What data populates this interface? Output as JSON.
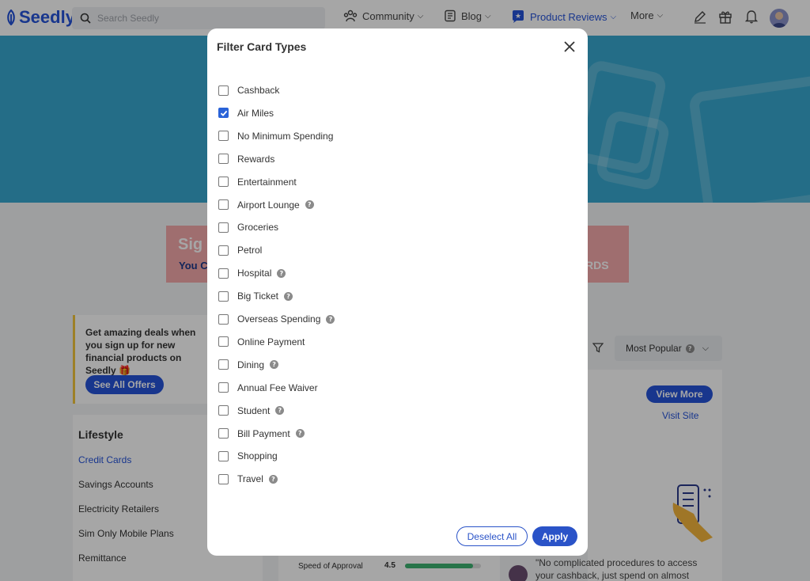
{
  "nav": {
    "logo": "Seedly",
    "search_placeholder": "Search Seedly",
    "community": "Community",
    "blog": "Blog",
    "product_reviews": "Product Reviews",
    "more": "More"
  },
  "banner": {
    "line1": "Sig",
    "line2": "You C",
    "line3": "RDS"
  },
  "offers": {
    "text": "Get amazing deals when you sign up for new financial products on Seedly",
    "button": "See All Offers"
  },
  "sidebar": {
    "heading": "Lifestyle",
    "items": [
      "Credit Cards",
      "Savings Accounts",
      "Electricity Retailers",
      "Sim Only Mobile Plans",
      "Remittance"
    ]
  },
  "sort": {
    "label": "Most Popular"
  },
  "card": {
    "view_more": "View More",
    "visit_site": "Visit Site",
    "rating_label": "Speed of Approval",
    "rating_value": "4.5",
    "rating_fraction": 0.9,
    "review_quote": "\"No complicated procedures to access your cashback, just spend on almost"
  },
  "modal": {
    "title": "Filter Card Types",
    "options": [
      {
        "label": "Cashback",
        "checked": false,
        "help": false
      },
      {
        "label": "Air Miles",
        "checked": true,
        "help": false
      },
      {
        "label": "No Minimum Spending",
        "checked": false,
        "help": false
      },
      {
        "label": "Rewards",
        "checked": false,
        "help": false
      },
      {
        "label": "Entertainment",
        "checked": false,
        "help": false
      },
      {
        "label": "Airport Lounge",
        "checked": false,
        "help": true
      },
      {
        "label": "Groceries",
        "checked": false,
        "help": false
      },
      {
        "label": "Petrol",
        "checked": false,
        "help": false
      },
      {
        "label": "Hospital",
        "checked": false,
        "help": true
      },
      {
        "label": "Big Ticket",
        "checked": false,
        "help": true
      },
      {
        "label": "Overseas Spending",
        "checked": false,
        "help": true
      },
      {
        "label": "Online Payment",
        "checked": false,
        "help": false
      },
      {
        "label": "Dining",
        "checked": false,
        "help": true
      },
      {
        "label": "Annual Fee Waiver",
        "checked": false,
        "help": false
      },
      {
        "label": "Student",
        "checked": false,
        "help": true
      },
      {
        "label": "Bill Payment",
        "checked": false,
        "help": true
      },
      {
        "label": "Shopping",
        "checked": false,
        "help": false
      },
      {
        "label": "Travel",
        "checked": false,
        "help": true
      }
    ],
    "deselect_all": "Deselect All",
    "apply": "Apply"
  }
}
